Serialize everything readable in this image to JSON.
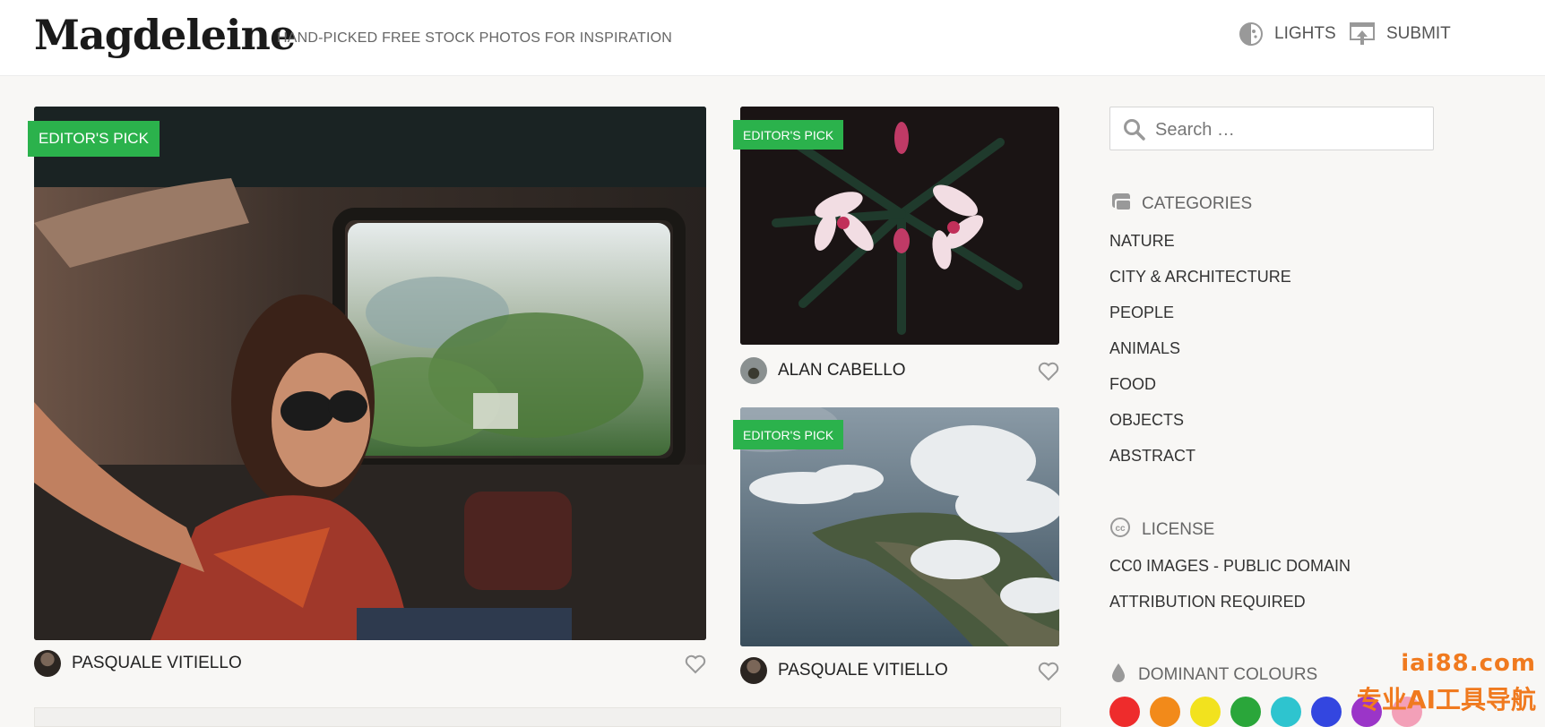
{
  "header": {
    "logo": "Magdeleine",
    "tagline": "HAND-PICKED FREE STOCK PHOTOS FOR INSPIRATION",
    "nav": [
      {
        "label": "LIGHTS",
        "icon": "lights-icon"
      },
      {
        "label": "SUBMIT",
        "icon": "upload-icon"
      }
    ]
  },
  "photos": [
    {
      "badge": "EDITOR'S PICK",
      "author": "PASQUALE VITIELLO",
      "subject": "woman with sunglasses in car"
    },
    {
      "badge": "EDITOR'S PICK",
      "author": "ALAN CABELLO",
      "subject": "pink flowers"
    },
    {
      "badge": "EDITOR'S PICK",
      "author": "PASQUALE VITIELLO",
      "subject": "coast under clouds"
    }
  ],
  "sidebar": {
    "search_placeholder": "Search …",
    "categories": {
      "title": "CATEGORIES",
      "items": [
        "NATURE",
        "CITY & ARCHITECTURE",
        "PEOPLE",
        "ANIMALS",
        "FOOD",
        "OBJECTS",
        "ABSTRACT"
      ]
    },
    "license": {
      "title": "LICENSE",
      "items": [
        "CC0 IMAGES - PUBLIC DOMAIN",
        "ATTRIBUTION REQUIRED"
      ]
    },
    "colours": {
      "title": "DOMINANT COLOURS",
      "swatches": [
        "#ee2c2c",
        "#f28a1a",
        "#f2e21e",
        "#2aa63a",
        "#2ec4cf",
        "#3346e0",
        "#9b35c8",
        "#f3a0b8"
      ]
    }
  },
  "watermark": {
    "line1": "iai88.com",
    "line2": "专业AI工具导航"
  }
}
